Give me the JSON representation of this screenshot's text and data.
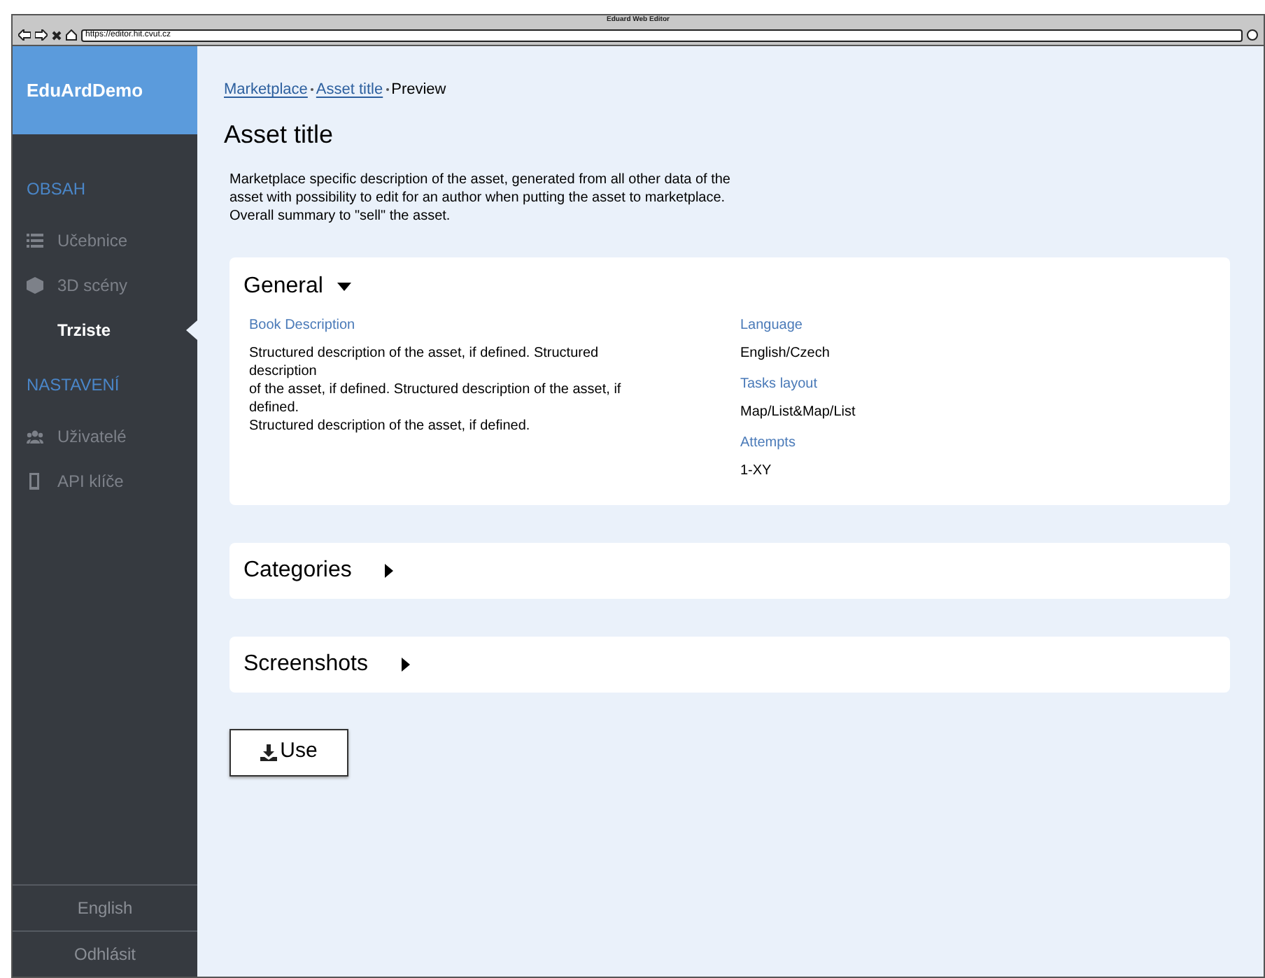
{
  "window": {
    "title": "Eduard Web Editor",
    "url": "https://editor.hit.cvut.cz"
  },
  "sidebar": {
    "brand": "EduArdDemo",
    "groups": [
      {
        "heading": "OBSAH",
        "items": [
          {
            "label": "Učebnice",
            "kind": "list",
            "selected": false
          },
          {
            "label": "3D scény",
            "kind": "cube",
            "selected": false
          },
          {
            "label": "Trziste",
            "kind": "plain",
            "selected": true
          }
        ]
      },
      {
        "heading": "NASTAVENÍ",
        "items": [
          {
            "label": "Uživatelé",
            "kind": "users",
            "selected": false
          },
          {
            "label": "API klíče",
            "kind": "phone",
            "selected": false
          }
        ]
      }
    ],
    "footer": [
      "English",
      "Odhlásit"
    ]
  },
  "breadcrumb": [
    {
      "label": "Marketplace",
      "kind": "link"
    },
    {
      "label": "Asset title",
      "kind": "link"
    },
    {
      "label": "Preview",
      "kind": "current"
    }
  ],
  "title": "Asset title",
  "description": "Marketplace specific description of the asset, generated from all other data of the asset with possibility to edit for an author when putting the asset to marketplace. Overall summary to \"sell\" the asset.",
  "sections": [
    {
      "title": "General",
      "expanded": true,
      "left": [
        {
          "label": "Book Description",
          "lines": [
            "Structured description of the asset, if defined. Structured description",
            "of the asset, if defined. Structured description of the asset, if defined.",
            "Structured description of the asset, if defined."
          ]
        }
      ],
      "right": [
        {
          "label": "Language",
          "lines": [
            "English/Czech"
          ]
        },
        {
          "label": "Tasks layout",
          "lines": [
            "Map/List&Map/List"
          ]
        },
        {
          "label": "Attempts",
          "lines": [
            "1-XY"
          ]
        }
      ]
    },
    {
      "title": "Categories",
      "expanded": false
    },
    {
      "title": "Screenshots",
      "expanded": false
    }
  ],
  "button": "Use"
}
